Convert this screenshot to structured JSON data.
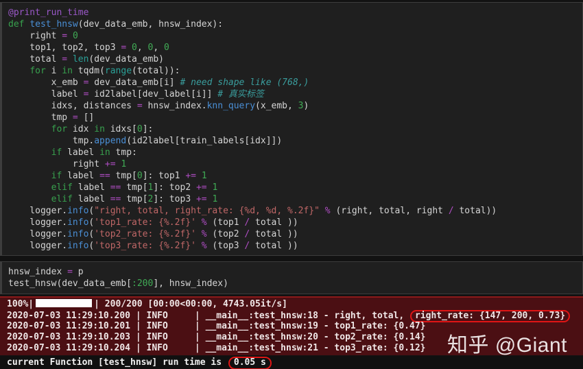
{
  "watermark": "知乎 @Giant",
  "colors": {
    "page_bg": "#121212",
    "panel_bg": "#1f1f1f",
    "panel_border": "#3d3d3d",
    "text_default": "#d5d5d5",
    "keyword": "#38a14e",
    "number": "#40ab55",
    "builtin": "#2aa198",
    "comment": "#3a9d9d",
    "function": "#4a8fd6",
    "operator": "#af4dc3",
    "string": "#c06767",
    "decorator": "#9b58c9",
    "output_bg": "#4b0f13",
    "output_border_top": "#8c1a1a",
    "output_text": "#f0e7e7",
    "highlight_red": "#e01515",
    "progress_bar": "#ffffff",
    "watermark_color": "#eae2e2",
    "bottom_bg": "#101010"
  },
  "code_panel": {
    "lines": [
      [
        [
          "d",
          "@print_run_time"
        ]
      ],
      [
        [
          "k",
          "def "
        ],
        [
          "f",
          "test_hnsw"
        ],
        [
          "t",
          "(dev_data_emb, hnsw_index):"
        ]
      ],
      [
        [
          "t",
          "    right "
        ],
        [
          "o",
          "="
        ],
        [
          "t",
          " "
        ],
        [
          "n",
          "0"
        ]
      ],
      [
        [
          "t",
          "    top1, top2, top3 "
        ],
        [
          "o",
          "="
        ],
        [
          "t",
          " "
        ],
        [
          "n",
          "0"
        ],
        [
          "t",
          ", "
        ],
        [
          "n",
          "0"
        ],
        [
          "t",
          ", "
        ],
        [
          "n",
          "0"
        ]
      ],
      [
        [
          "t",
          "    total "
        ],
        [
          "o",
          "="
        ],
        [
          "t",
          " "
        ],
        [
          "b",
          "len"
        ],
        [
          "t",
          "(dev_data_emb)"
        ]
      ],
      [
        [
          "t",
          "    "
        ],
        [
          "k",
          "for"
        ],
        [
          "t",
          " i "
        ],
        [
          "k",
          "in"
        ],
        [
          "t",
          " tqdm("
        ],
        [
          "b",
          "range"
        ],
        [
          "t",
          "(total)):"
        ]
      ],
      [
        [
          "t",
          "        x_emb "
        ],
        [
          "o",
          "="
        ],
        [
          "t",
          " dev_data_emb[i] "
        ],
        [
          "c",
          "# need shape like (768,)"
        ]
      ],
      [
        [
          "t",
          "        label "
        ],
        [
          "o",
          "="
        ],
        [
          "t",
          " id2label[dev_label[i]] "
        ],
        [
          "c",
          "# 真实标签"
        ]
      ],
      [
        [
          "t",
          "        idxs, distances "
        ],
        [
          "o",
          "="
        ],
        [
          "t",
          " hnsw_index."
        ],
        [
          "f",
          "knn_query"
        ],
        [
          "t",
          "(x_emb, "
        ],
        [
          "n",
          "3"
        ],
        [
          "t",
          ")"
        ]
      ],
      [
        [
          "t",
          "        tmp "
        ],
        [
          "o",
          "="
        ],
        [
          "t",
          " []"
        ]
      ],
      [
        [
          "t",
          "        "
        ],
        [
          "k",
          "for"
        ],
        [
          "t",
          " idx "
        ],
        [
          "k",
          "in"
        ],
        [
          "t",
          " idxs["
        ],
        [
          "n",
          "0"
        ],
        [
          "t",
          "]:"
        ]
      ],
      [
        [
          "t",
          "            tmp."
        ],
        [
          "f",
          "append"
        ],
        [
          "t",
          "(id2label[train_labels[idx]])"
        ]
      ],
      [
        [
          "t",
          "        "
        ],
        [
          "k",
          "if"
        ],
        [
          "t",
          " label "
        ],
        [
          "k",
          "in"
        ],
        [
          "t",
          " tmp:"
        ]
      ],
      [
        [
          "t",
          "            right "
        ],
        [
          "o",
          "+="
        ],
        [
          "t",
          " "
        ],
        [
          "n",
          "1"
        ]
      ],
      [
        [
          "t",
          "        "
        ],
        [
          "k",
          "if"
        ],
        [
          "t",
          " label "
        ],
        [
          "o",
          "=="
        ],
        [
          "t",
          " tmp["
        ],
        [
          "n",
          "0"
        ],
        [
          "t",
          "]: top1 "
        ],
        [
          "o",
          "+="
        ],
        [
          "t",
          " "
        ],
        [
          "n",
          "1"
        ]
      ],
      [
        [
          "t",
          "        "
        ],
        [
          "k",
          "elif"
        ],
        [
          "t",
          " label "
        ],
        [
          "o",
          "=="
        ],
        [
          "t",
          " tmp["
        ],
        [
          "n",
          "1"
        ],
        [
          "t",
          "]: top2 "
        ],
        [
          "o",
          "+="
        ],
        [
          "t",
          " "
        ],
        [
          "n",
          "1"
        ]
      ],
      [
        [
          "t",
          "        "
        ],
        [
          "k",
          "elif"
        ],
        [
          "t",
          " label "
        ],
        [
          "o",
          "=="
        ],
        [
          "t",
          " tmp["
        ],
        [
          "n",
          "2"
        ],
        [
          "t",
          "]: top3 "
        ],
        [
          "o",
          "+="
        ],
        [
          "t",
          " "
        ],
        [
          "n",
          "1"
        ]
      ],
      [
        [
          "t",
          "    logger."
        ],
        [
          "f",
          "info"
        ],
        [
          "t",
          "("
        ],
        [
          "s",
          "\"right, total, right_rate: {%d, %d, %.2f}\""
        ],
        [
          "t",
          " "
        ],
        [
          "o",
          "%"
        ],
        [
          "t",
          " (right, total, right "
        ],
        [
          "o",
          "/"
        ],
        [
          "t",
          " total))"
        ]
      ],
      [
        [
          "t",
          "    logger."
        ],
        [
          "f",
          "info"
        ],
        [
          "t",
          "("
        ],
        [
          "s",
          "'top1_rate: {%.2f}'"
        ],
        [
          "t",
          " "
        ],
        [
          "o",
          "%"
        ],
        [
          "t",
          " (top1 "
        ],
        [
          "o",
          "/"
        ],
        [
          "t",
          " total ))"
        ]
      ],
      [
        [
          "t",
          "    logger."
        ],
        [
          "f",
          "info"
        ],
        [
          "t",
          "("
        ],
        [
          "s",
          "'top2_rate: {%.2f}'"
        ],
        [
          "t",
          " "
        ],
        [
          "o",
          "%"
        ],
        [
          "t",
          " (top2 "
        ],
        [
          "o",
          "/"
        ],
        [
          "t",
          " total ))"
        ]
      ],
      [
        [
          "t",
          "    logger."
        ],
        [
          "f",
          "info"
        ],
        [
          "t",
          "("
        ],
        [
          "s",
          "'top3_rate: {%.2f}'"
        ],
        [
          "t",
          " "
        ],
        [
          "o",
          "%"
        ],
        [
          "t",
          " (top3 "
        ],
        [
          "o",
          "/"
        ],
        [
          "t",
          " total ))"
        ]
      ]
    ]
  },
  "snippet_panel": {
    "lines": [
      [
        [
          "t",
          "hnsw_index "
        ],
        [
          "o",
          "="
        ],
        [
          "t",
          " p"
        ]
      ],
      [
        [
          "t",
          "test_hnsw(dev_data_emb["
        ],
        [
          "n",
          ":200"
        ],
        [
          "t",
          "], hnsw_index)"
        ]
      ]
    ]
  },
  "output_panel": {
    "progress": {
      "prefix": "100%|",
      "suffix": "| 200/200 [00:00<00:00, 4743.05it/s]"
    },
    "log_lines": [
      {
        "text": "2020-07-03 11:29:10.200 | INFO     | __main__:test_hnsw:18 - right, total, ",
        "highlight": "right_rate: {147, 200, 0.73}"
      },
      {
        "text": "2020-07-03 11:29:10.201 | INFO     | __main__:test_hnsw:19 - top1_rate: {0.47}"
      },
      {
        "text": "2020-07-03 11:29:10.203 | INFO     | __main__:test_hnsw:20 - top2_rate: {0.14}"
      },
      {
        "text": "2020-07-03 11:29:10.204 | INFO     | __main__:test_hnsw:21 - top3_rate: {0.12}"
      }
    ],
    "runtime": {
      "text": "current Function [test_hnsw] run time is ",
      "highlight": "0.05 s"
    }
  }
}
